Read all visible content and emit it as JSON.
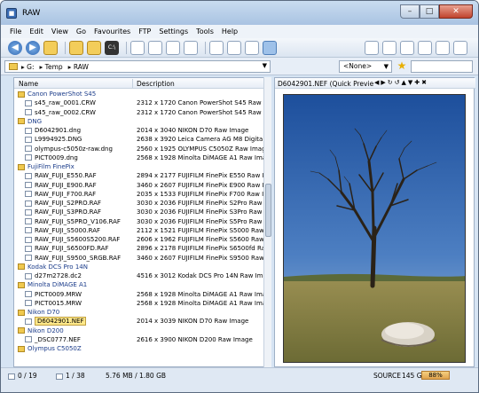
{
  "window": {
    "title": "RAW",
    "minimize": "–",
    "maximize": "□",
    "close": "✕"
  },
  "menu": [
    "File",
    "Edit",
    "View",
    "Go",
    "Favourites",
    "FTP",
    "Settings",
    "Tools",
    "Help"
  ],
  "address": {
    "crumbs": [
      "G:",
      "Temp",
      "RAW"
    ],
    "filter": "<None>"
  },
  "columns": {
    "name": "Name",
    "description": "Description"
  },
  "rows": [
    {
      "type": "group",
      "name": "Canon PowerShot S45",
      "desc": ""
    },
    {
      "type": "file",
      "name": "s45_raw_0001.CRW",
      "desc": "2312 x 1720 Canon PowerShot S45 Raw Ima..."
    },
    {
      "type": "file",
      "name": "s45_raw_0002.CRW",
      "desc": "2312 x 1720 Canon PowerShot S45 Raw Ima..."
    },
    {
      "type": "group",
      "name": "DNG",
      "desc": ""
    },
    {
      "type": "file",
      "name": "D6042901.dng",
      "desc": "2014 x 3040 NIKON D70 Raw Image"
    },
    {
      "type": "file",
      "name": "L9994925.DNG",
      "desc": "2638 x 3920 Leica Camera AG M8 Digital C..."
    },
    {
      "type": "file",
      "name": "olympus-c5050z-raw.dng",
      "desc": "2560 x 1925 OLYMPUS C5050Z Raw Image"
    },
    {
      "type": "file",
      "name": "PICT0009.dng",
      "desc": "2568 x 1928 Minolta DiMAGE A1 Raw Image"
    },
    {
      "type": "group",
      "name": "FujiFilm FinePix",
      "desc": ""
    },
    {
      "type": "file",
      "name": "RAW_FUJI_E550.RAF",
      "desc": "2894 x 2177 FUJIFILM FinePix E550 Raw Im..."
    },
    {
      "type": "file",
      "name": "RAW_FUJI_E900.RAF",
      "desc": "3460 x 2607 FUJIFILM FinePix E900 Raw Im..."
    },
    {
      "type": "file",
      "name": "RAW_FUJI_F700.RAF",
      "desc": "2035 x 1533 FUJIFILM FinePix F700 Raw Im..."
    },
    {
      "type": "file",
      "name": "RAW_FUJI_S2PRO.RAF",
      "desc": "3030 x 2036 FUJIFILM FinePix S2Pro Raw I..."
    },
    {
      "type": "file",
      "name": "RAW_FUJI_S3PRO.RAF",
      "desc": "3030 x 2036 FUJIFILM FinePix S3Pro Raw I..."
    },
    {
      "type": "file",
      "name": "RAW_FUJI_S5PRO_V106.RAF",
      "desc": "3030 x 2036 FUJIFILM FinePix S5Pro Raw I..."
    },
    {
      "type": "file",
      "name": "RAW_FUJI_S5000.RAF",
      "desc": "2112 x 1521 FUJIFILM FinePix S5000 Raw I..."
    },
    {
      "type": "file",
      "name": "RAW_FUJI_S5600S5200.RAF",
      "desc": "2606 x 1962 FUJIFILM FinePix S5600 Raw I..."
    },
    {
      "type": "file",
      "name": "RAW_FUJI_S6500FD.RAF",
      "desc": "2896 x 2178 FUJIFILM FinePix S6500fd Raw..."
    },
    {
      "type": "file",
      "name": "RAW_FUJI_S9500_SRGB.RAF",
      "desc": "3460 x 2607 FUJIFILM FinePix S9500 Raw I..."
    },
    {
      "type": "group",
      "name": "Kodak DCS Pro 14N",
      "desc": ""
    },
    {
      "type": "file",
      "name": "d27m2728.dc2",
      "desc": "4516 x 3012 Kodak DCS Pro 14N Raw Image"
    },
    {
      "type": "group",
      "name": "Minolta DiMAGE A1",
      "desc": ""
    },
    {
      "type": "file",
      "name": "PICT0009.MRW",
      "desc": "2568 x 1928 Minolta DiMAGE A1 Raw Image"
    },
    {
      "type": "file",
      "name": "PICT0015.MRW",
      "desc": "2568 x 1928 Minolta DiMAGE A1 Raw Image"
    },
    {
      "type": "group",
      "name": "Nikon D70",
      "desc": ""
    },
    {
      "type": "file",
      "name": "D6042901.NEF",
      "desc": "2014 x 3039 NIKON D70 Raw Image",
      "selected": true
    },
    {
      "type": "group",
      "name": "Nikon D200",
      "desc": ""
    },
    {
      "type": "file",
      "name": "_DSC0777.NEF",
      "desc": "2616 x 3900 NIKON D200 Raw Image"
    },
    {
      "type": "group",
      "name": "Olympus C5050Z",
      "desc": ""
    }
  ],
  "preview": {
    "title": "D6042901.NEF (Quick Preview..."
  },
  "status": {
    "selection": "0 / 19",
    "files": "1 / 38",
    "size": "5.76 MB / 1.80 GB",
    "source": "SOURCE",
    "free": "145 GB",
    "percent": "88%"
  },
  "colors": {
    "accent": "#2f67b3",
    "group_text": "#1b3c8a",
    "selected": "#ffe88a"
  }
}
